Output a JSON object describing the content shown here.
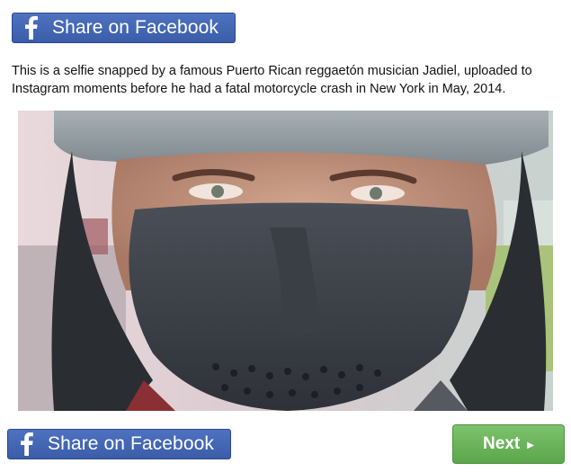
{
  "share_top": {
    "label": "Share on Facebook",
    "icon": "facebook-f-icon"
  },
  "caption": "This is a selfie snapped by a famous Puerto Rican reggaetón musician Jadiel, uploaded to Instagram moments before he had a fatal motorcycle crash in New York in May, 2014.",
  "share_bottom": {
    "label": "Share on Facebook",
    "icon": "facebook-f-icon"
  },
  "next": {
    "label": "Next",
    "icon": "play-arrow-icon"
  },
  "colors": {
    "facebook_blue": "#3b5da9",
    "next_green": "#6cb45b"
  }
}
